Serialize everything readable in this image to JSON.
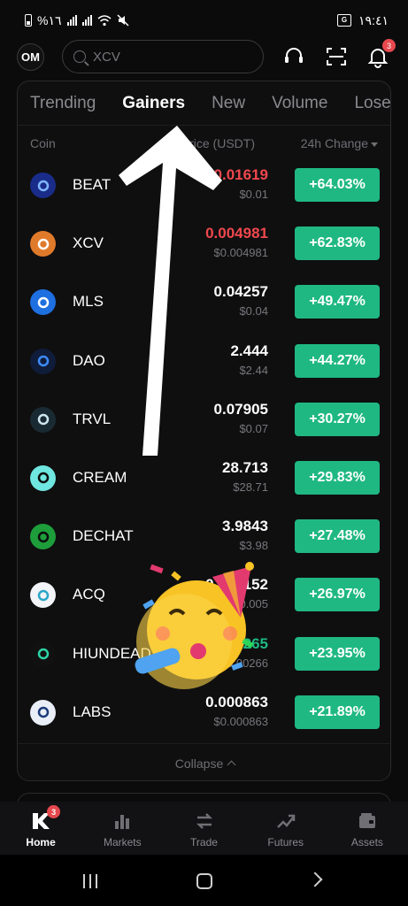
{
  "status_bar": {
    "left_text": "%١٦",
    "time": "١٩:٤١"
  },
  "header": {
    "avatar_initials": "OM",
    "search_placeholder": "XCV",
    "notification_count": "3"
  },
  "tabs": [
    {
      "label": "Trending",
      "active": false
    },
    {
      "label": "Gainers",
      "active": true
    },
    {
      "label": "New",
      "active": false
    },
    {
      "label": "Volume",
      "active": false
    },
    {
      "label": "Loser",
      "active": false
    }
  ],
  "columns": {
    "coin": "Coin",
    "price": "Price (USDT)",
    "change": "24h Change"
  },
  "coins": [
    {
      "name": "BEAT",
      "price": "0.01619",
      "usd": "$0.01",
      "change": "+64.03%",
      "price_color": "red",
      "icon_bg": "#1a2c8a",
      "icon_fg": "#7fb6ff",
      "icon_name": "beat-coin-icon"
    },
    {
      "name": "XCV",
      "price": "0.004981",
      "usd": "$0.004981",
      "change": "+62.83%",
      "price_color": "red",
      "icon_bg": "#e07a2b",
      "icon_fg": "#fff",
      "icon_name": "xcv-coin-icon"
    },
    {
      "name": "MLS",
      "price": "0.04257",
      "usd": "$0.04",
      "change": "+49.47%",
      "price_color": "white",
      "icon_bg": "#1e6fe0",
      "icon_fg": "#fff",
      "icon_name": "mls-coin-icon"
    },
    {
      "name": "DAO",
      "price": "2.444",
      "usd": "$2.44",
      "change": "+44.27%",
      "price_color": "white",
      "icon_bg": "#0f1d3a",
      "icon_fg": "#3d8bff",
      "icon_name": "dao-coin-icon"
    },
    {
      "name": "TRVL",
      "price": "0.07905",
      "usd": "$0.07",
      "change": "+30.27%",
      "price_color": "white",
      "icon_bg": "#1a2a33",
      "icon_fg": "#cfe6ef",
      "icon_name": "trvl-coin-icon"
    },
    {
      "name": "CREAM",
      "price": "28.713",
      "usd": "$28.71",
      "change": "+29.83%",
      "price_color": "white",
      "icon_bg": "#6fe6e0",
      "icon_fg": "#0b0b0c",
      "icon_name": "cream-coin-icon"
    },
    {
      "name": "DECHAT",
      "price": "3.9843",
      "usd": "$3.98",
      "change": "+27.48%",
      "price_color": "white",
      "icon_bg": "#1e9e3a",
      "icon_fg": "#0b0b0c",
      "icon_name": "dechat-coin-icon"
    },
    {
      "name": "ACQ",
      "price": "0.005152",
      "usd": "$0.005",
      "change": "+26.97%",
      "price_color": "white",
      "icon_bg": "#f2f4f7",
      "icon_fg": "#2aa6c8",
      "icon_name": "acq-coin-icon"
    },
    {
      "name": "HIUNDEAD",
      "price": "0.00265",
      "usd": "$0.00266",
      "change": "+23.95%",
      "price_color": "green",
      "icon_bg": "#111",
      "icon_fg": "#2dd4a7",
      "icon_name": "hiundead-coin-icon"
    },
    {
      "name": "LABS",
      "price": "0.000863",
      "usd": "$0.000863",
      "change": "+21.89%",
      "price_color": "white",
      "icon_bg": "#e9eef7",
      "icon_fg": "#1a3a7a",
      "icon_name": "labs-coin-icon"
    }
  ],
  "collapse_label": "Collapse",
  "bottom_nav": [
    {
      "label": "Home",
      "active": true,
      "icon": "home-icon"
    },
    {
      "label": "Markets",
      "active": false,
      "icon": "markets-icon"
    },
    {
      "label": "Trade",
      "active": false,
      "icon": "trade-icon"
    },
    {
      "label": "Futures",
      "active": false,
      "icon": "futures-icon"
    },
    {
      "label": "Assets",
      "active": false,
      "icon": "assets-icon"
    }
  ],
  "home_badge": "3",
  "colors": {
    "gain_green": "#1fb883",
    "loss_red": "#f0484d",
    "badge_red": "#e5484d"
  }
}
